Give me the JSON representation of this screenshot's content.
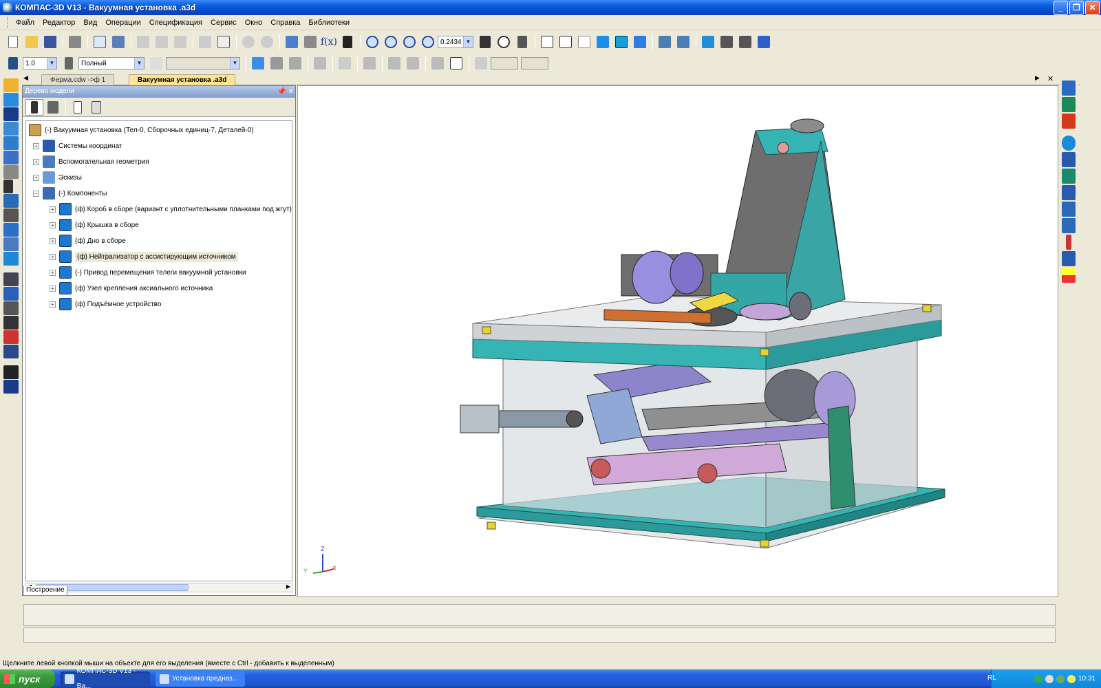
{
  "window": {
    "title": "КОМПАС-3D V13 - Вакуумная установка .a3d"
  },
  "menu": [
    "Файл",
    "Редактор",
    "Вид",
    "Операции",
    "Спецификация",
    "Сервис",
    "Окно",
    "Справка",
    "Библиотеки"
  ],
  "toolbar": {
    "zoom_value": "0.2434",
    "step_value": "1.0",
    "view_mode": "Полный",
    "fx_label": "f(x)"
  },
  "doc_tabs": [
    "Ферма.cdw ->ф 1",
    "Вакуумная установка .a3d"
  ],
  "tree": {
    "panel_title": "Дерево модели",
    "root": "(-) Вакуумная установка  (Тел-0, Сборочных единиц-7, Деталей-0)",
    "items": [
      {
        "label": "Системы координат",
        "expander": "+"
      },
      {
        "label": "Вспомогательная геометрия",
        "expander": "+"
      },
      {
        "label": "Эскизы",
        "expander": "+"
      },
      {
        "label": "(-) Компоненты",
        "expander": "−"
      }
    ],
    "components": [
      {
        "label": "(ф) Короб в сборе    (вариант с уплотнительными планками под жгут)"
      },
      {
        "label": "(ф) Крышка в сборе"
      },
      {
        "label": "(ф) Дно в сборе"
      },
      {
        "label": "(ф) Нейтрализатор с ассистирующим источником",
        "highlighted": true
      },
      {
        "label": "(-) Привод перемещения телеги вакуумной установки"
      },
      {
        "label": "(ф) Узел крепления аксиального источника"
      },
      {
        "label": "(ф) Подъёмное устройство"
      }
    ],
    "bottom_tab": "Построение"
  },
  "viewport": {
    "axis_z": "Z",
    "axis_y": "Y",
    "axis_x": "X"
  },
  "status": {
    "hint": "Щелкните левой кнопкой мыши на объекте для его выделения (вместе с Ctrl - добавить к выделенным)"
  },
  "taskbar": {
    "start": "пуск",
    "tasks": [
      "КОМПАС-3D V13 - Ва...",
      "Установка предназ..."
    ],
    "lang": "RL",
    "clock": "10:31"
  },
  "colors": {
    "frame": "#2fa3a3",
    "accent_panel": "#ffe592"
  }
}
